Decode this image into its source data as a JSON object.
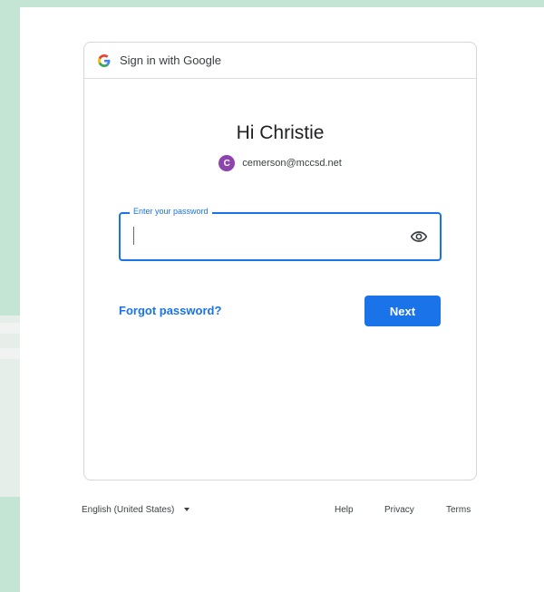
{
  "header": {
    "title": "Sign in with Google",
    "logo_icon": "google-g-icon"
  },
  "greeting": "Hi Christie",
  "account": {
    "avatar_initial": "C",
    "avatar_color": "#8e44ad",
    "email": "cemerson@mccsd.net"
  },
  "password": {
    "label": "Enter your password",
    "value": "",
    "toggle_icon": "eye-icon"
  },
  "actions": {
    "forgot_label": "Forgot password?",
    "next_label": "Next"
  },
  "footer": {
    "language": "English (United States)",
    "help": "Help",
    "privacy": "Privacy",
    "terms": "Terms"
  },
  "colors": {
    "accent": "#1a73e8",
    "background": "#c4e4d4"
  }
}
